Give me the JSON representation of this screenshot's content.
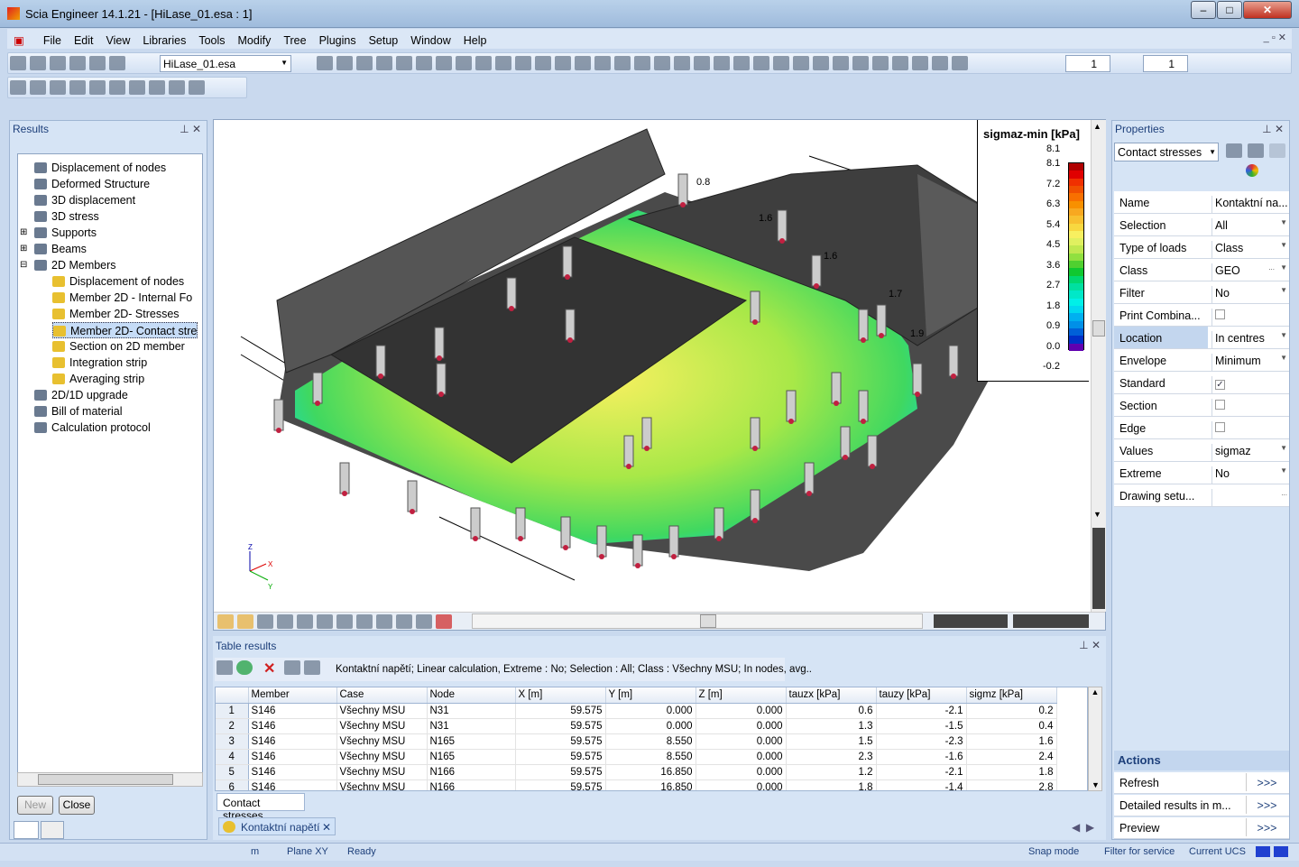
{
  "window": {
    "title": "Scia Engineer 14.1.21 - [HiLase_01.esa : 1]"
  },
  "menu": [
    "File",
    "Edit",
    "View",
    "Libraries",
    "Tools",
    "Modify",
    "Tree",
    "Plugins",
    "Setup",
    "Window",
    "Help"
  ],
  "toolbar": {
    "file_combo": "HiLase_01.esa",
    "spin1": "1",
    "spin2": "1"
  },
  "results": {
    "title": "Results",
    "items": [
      {
        "label": "Displacement of nodes",
        "level": 0,
        "icon": "displacement-icon"
      },
      {
        "label": "Deformed Structure",
        "level": 0,
        "icon": "deformed-icon"
      },
      {
        "label": "3D displacement",
        "level": 0,
        "icon": "3d-displacement-icon"
      },
      {
        "label": "3D stress",
        "level": 0,
        "icon": "3d-stress-icon"
      },
      {
        "label": "Supports",
        "level": 0,
        "icon": "supports-icon",
        "expand": "+"
      },
      {
        "label": "Beams",
        "level": 0,
        "icon": "beams-icon",
        "expand": "+"
      },
      {
        "label": "2D Members",
        "level": 0,
        "icon": "2d-members-icon",
        "expand": "-"
      },
      {
        "label": "Displacement of nodes",
        "level": 1,
        "icon": "member-icon"
      },
      {
        "label": "Member 2D - Internal Fo",
        "level": 1,
        "icon": "member-icon"
      },
      {
        "label": "Member 2D- Stresses",
        "level": 1,
        "icon": "member-icon"
      },
      {
        "label": "Member 2D- Contact stre",
        "level": 1,
        "icon": "member-icon",
        "selected": true
      },
      {
        "label": "Section on 2D member",
        "level": 1,
        "icon": "section-icon"
      },
      {
        "label": "Integration strip",
        "level": 1,
        "icon": "strip-icon"
      },
      {
        "label": "Averaging strip",
        "level": 1,
        "icon": "strip-icon"
      },
      {
        "label": "2D/1D upgrade",
        "level": 0,
        "icon": "upgrade-icon"
      },
      {
        "label": "Bill of material",
        "level": 0,
        "icon": "bill-icon"
      },
      {
        "label": "Calculation protocol",
        "level": 0,
        "icon": "protocol-icon"
      }
    ],
    "new_label": "New",
    "close_label": "Close"
  },
  "viewport": {
    "legend": {
      "title": "sigmaz-min [kPa]",
      "max_label": "8.1",
      "ticks": [
        "8.1",
        "7.2",
        "6.3",
        "5.4",
        "4.5",
        "3.6",
        "2.7",
        "1.8",
        "0.9",
        "0.0",
        "-0.2"
      ],
      "colors": [
        "#b00000",
        "#e00000",
        "#f03000",
        "#f05000",
        "#f87000",
        "#f89000",
        "#f8a820",
        "#f8c030",
        "#f8d840",
        "#f8f060",
        "#e0f060",
        "#c0e850",
        "#90e040",
        "#50d030",
        "#10c830",
        "#00d870",
        "#00e0a0",
        "#00e8c8",
        "#00f0e8",
        "#00d8f0",
        "#00b0f0",
        "#0090e8",
        "#0060d8",
        "#0030c8",
        "#6000b0"
      ]
    },
    "axis": {
      "x": "X",
      "y": "Y",
      "z": "Z"
    },
    "value_labels": [
      "0.8",
      "1.6",
      "1.6",
      "1.7",
      "1.9"
    ]
  },
  "table": {
    "title": "Table results",
    "summary": "Kontaktní napětí; Linear calculation, Extreme : No; Selection : All; Class : Všechny MSU; In nodes, avg..",
    "columns": [
      "Member",
      "Case",
      "Node",
      "X [m]",
      "Y [m]",
      "Z [m]",
      "tauzx [kPa]",
      "tauzy [kPa]",
      "sigmz [kPa]"
    ],
    "rows": [
      [
        "1",
        "S146",
        "Všechny MSU",
        "N31",
        "59.575",
        "0.000",
        "0.000",
        "0.6",
        "-2.1",
        "0.2"
      ],
      [
        "2",
        "S146",
        "Všechny MSU",
        "N31",
        "59.575",
        "0.000",
        "0.000",
        "1.3",
        "-1.5",
        "0.4"
      ],
      [
        "3",
        "S146",
        "Všechny MSU",
        "N165",
        "59.575",
        "8.550",
        "0.000",
        "1.5",
        "-2.3",
        "1.6"
      ],
      [
        "4",
        "S146",
        "Všechny MSU",
        "N165",
        "59.575",
        "8.550",
        "0.000",
        "2.3",
        "-1.6",
        "2.4"
      ],
      [
        "5",
        "S146",
        "Všechny MSU",
        "N166",
        "59.575",
        "16.850",
        "0.000",
        "1.2",
        "-2.1",
        "1.8"
      ],
      [
        "6",
        "S146",
        "Všechny MSU",
        "N166",
        "59.575",
        "16.850",
        "0.000",
        "1.8",
        "-1.4",
        "2.8"
      ]
    ],
    "tab": "Contact stresses",
    "doc_tab": "Kontaktní napětí"
  },
  "properties": {
    "title": "Properties",
    "combo": "Contact stresses",
    "rows": [
      {
        "k": "Name",
        "v": "Kontaktní na..."
      },
      {
        "k": "Selection",
        "v": "All",
        "dd": true
      },
      {
        "k": "Type of loads",
        "v": "Class",
        "dd": true
      },
      {
        "k": "Class",
        "v": "GEO",
        "dd": true,
        "more": true
      },
      {
        "k": "Filter",
        "v": "No",
        "dd": true
      },
      {
        "k": "Print Combina...",
        "v": "",
        "check": false
      },
      {
        "k": "Location",
        "v": "In centres",
        "dd": true,
        "hl": true
      },
      {
        "k": "Envelope",
        "v": "Minimum",
        "dd": true
      },
      {
        "k": "Standard",
        "v": "",
        "check": true
      },
      {
        "k": "Section",
        "v": "",
        "check": false
      },
      {
        "k": "Edge",
        "v": "",
        "check": false
      },
      {
        "k": "Values",
        "v": "sigmaz",
        "dd": true
      },
      {
        "k": "Extreme",
        "v": "No",
        "dd": true
      },
      {
        "k": "Drawing setu...",
        "v": "",
        "more": true
      }
    ],
    "actions_title": "Actions",
    "actions": [
      {
        "label": "Refresh",
        "btn": ">>>"
      },
      {
        "label": "Detailed results in m...",
        "btn": ">>>"
      },
      {
        "label": "Preview",
        "btn": ">>>"
      }
    ]
  },
  "status": {
    "units": "m",
    "plane": "Plane XY",
    "state": "Ready",
    "snap": "Snap mode",
    "filter": "Filter for service",
    "ucs": "Current UCS"
  }
}
